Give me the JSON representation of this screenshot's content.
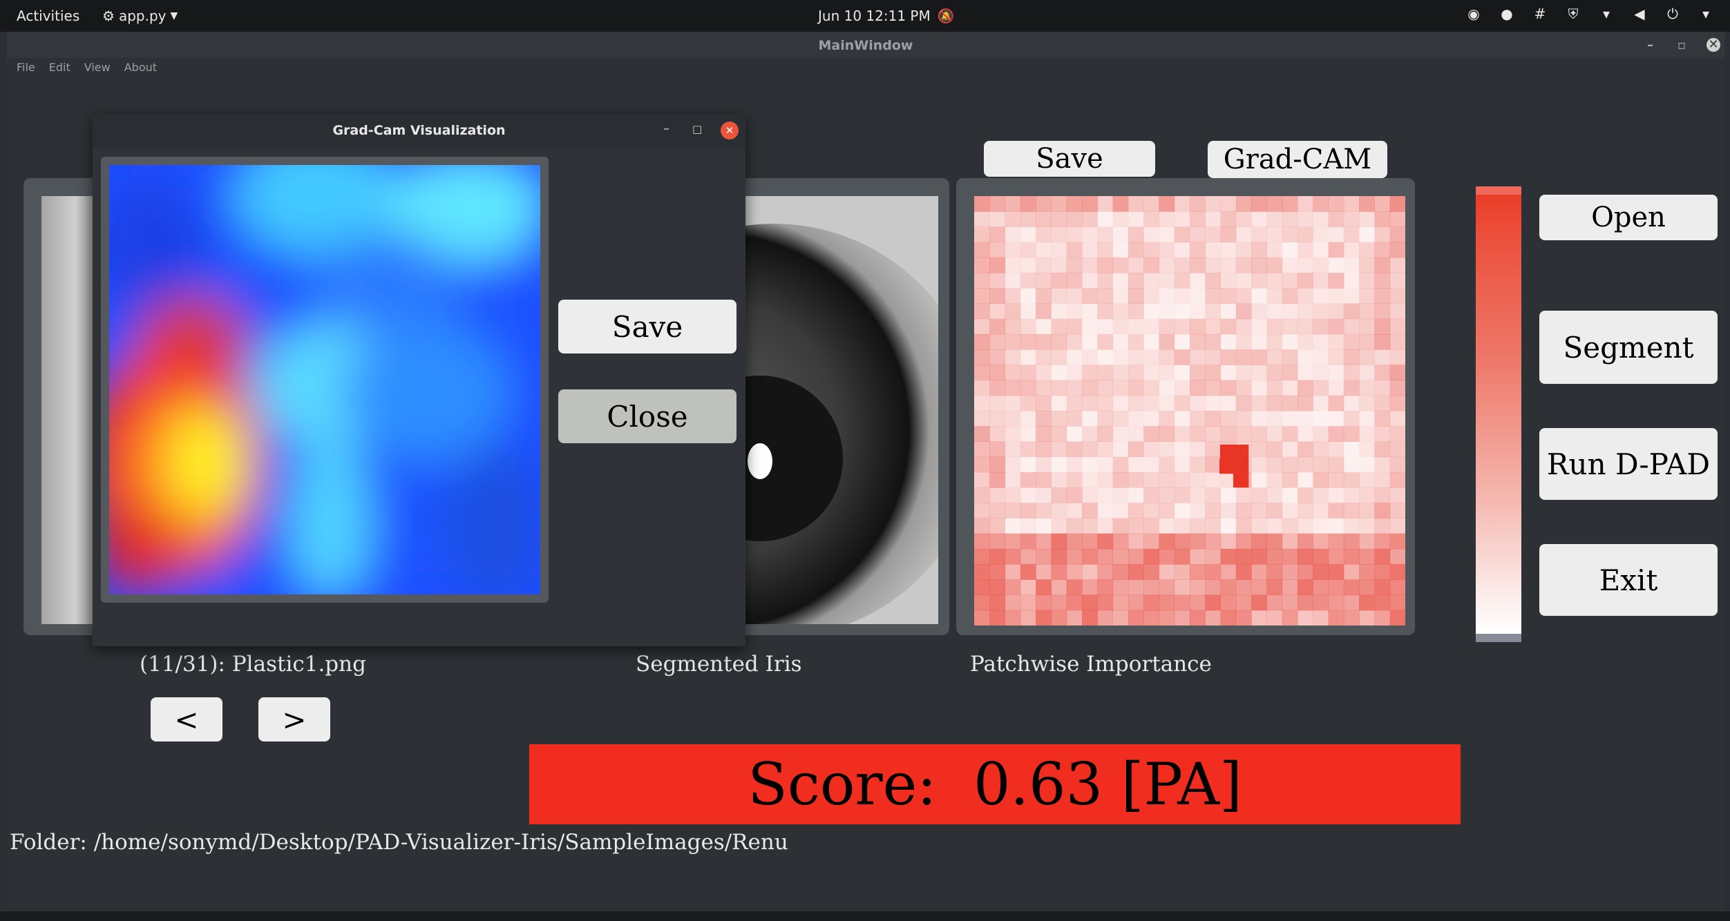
{
  "topbar": {
    "activities": "Activities",
    "app_name": "app.py",
    "clock": "Jun 10  12:11 PM"
  },
  "window": {
    "title": "MainWindow",
    "menu": [
      "File",
      "Edit",
      "View",
      "About"
    ]
  },
  "buttons": {
    "save_top": "Save",
    "gradcam": "Grad-CAM",
    "open": "Open",
    "segment": "Segment",
    "run_dpad": "Run D-PAD",
    "exit": "Exit",
    "prev": "<",
    "next": ">"
  },
  "captions": {
    "image_name": "(11/31): Plastic1.png",
    "segmented": "Segmented Iris",
    "patchwise": "Patchwise Importance"
  },
  "score": {
    "text": "Score:  0.63 [PA]",
    "color": "#f02d1f"
  },
  "folder": "Folder: /home/sonymd/Desktop/PAD-Visualizer-Iris/SampleImages/Renu",
  "dialog": {
    "title": "Grad-Cam Visualization",
    "save": "Save",
    "close": "Close"
  },
  "icons": {
    "tray": [
      "chrome-icon",
      "user-icon",
      "slack-icon",
      "shield-icon",
      "wifi-icon",
      "volume-icon",
      "power-icon",
      "chevron-down-icon"
    ]
  }
}
